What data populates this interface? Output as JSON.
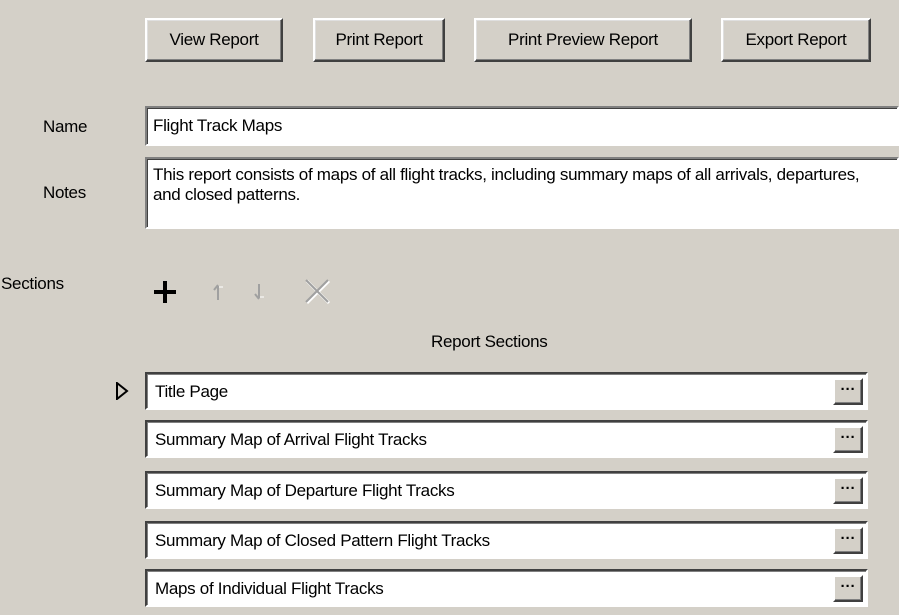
{
  "toolbar": {
    "view_report": "View Report",
    "print_report": "Print Report",
    "print_preview_report": "Print Preview Report",
    "export_report": "Export Report"
  },
  "name": {
    "label": "Name",
    "value": "Flight Track Maps"
  },
  "notes": {
    "label": "Notes",
    "value": "This report consists of maps of all flight tracks, including summary maps of all arrivals, departures, and closed patterns."
  },
  "sections": {
    "label": "Sections",
    "header": "Report Sections",
    "tools": {
      "add": "add-icon",
      "move_up": "arrow-up-icon",
      "move_down": "arrow-down-icon",
      "delete": "delete-icon"
    },
    "ellipsis": "···",
    "items": [
      {
        "label": "Title Page"
      },
      {
        "label": "Summary Map of Arrival Flight Tracks"
      },
      {
        "label": "Summary Map of Departure Flight Tracks"
      },
      {
        "label": "Summary Map of Closed Pattern Flight Tracks"
      },
      {
        "label": "Maps of Individual Flight Tracks"
      }
    ]
  },
  "colors": {
    "window_bg": "#d4d0c8",
    "field_bg": "#ffffff",
    "disabled_icon": "#a0a0a0"
  }
}
